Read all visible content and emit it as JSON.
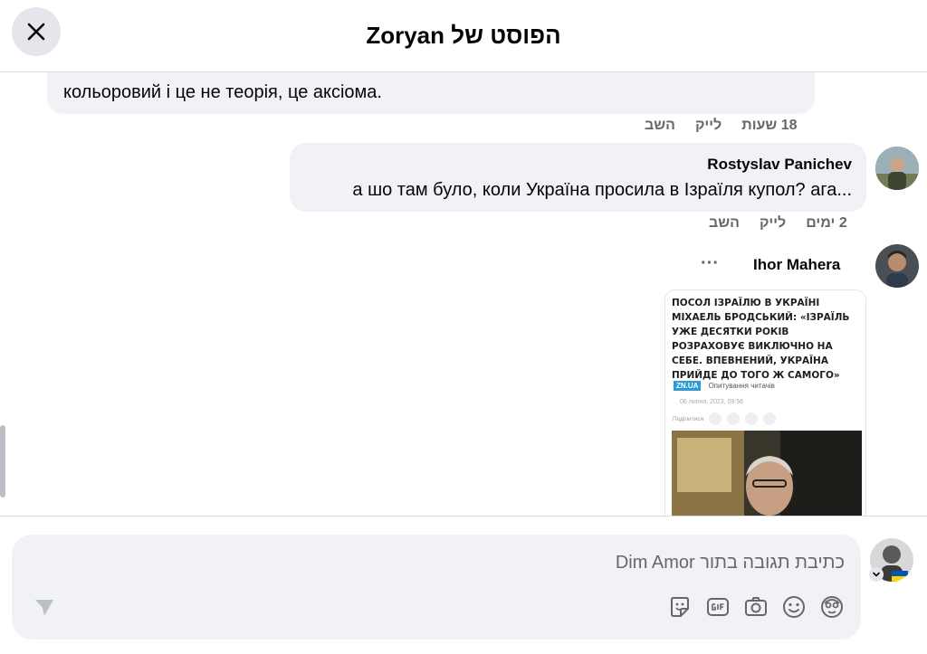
{
  "header": {
    "title": "הפוסט של Zoryan",
    "close_label": "×"
  },
  "comments": [
    {
      "text": "кольоровий і це не теорія, це аксіома.",
      "meta": {
        "time": "18 שעות",
        "like": "לייק",
        "reply": "השב"
      }
    },
    {
      "author": "Rostyslav Panichev",
      "text": "а шо там було, коли Україна просила в Ізраїля купол? ага...",
      "meta": {
        "time": "2 ימים",
        "like": "לייק",
        "reply": "השב"
      }
    },
    {
      "author": "Ihor Mahera",
      "more": "···",
      "attachment": {
        "headline_lines": [
          "ПОСОЛ ІЗРАЇЛЮ В УКРАЇНІ",
          "МІХАЕЛЬ БРОДСЬКИЙ: «ІЗРАЇЛЬ",
          "УЖЕ ДЕСЯТКИ РОКІВ",
          "РОЗРАХОВУЄ ВИКЛЮЧНО НА",
          "СЕБЕ. ВПЕВНЕНИЙ, УКРАЇНА",
          "ПРИЙДЕ ДО ТОГО Ж САМОГО»"
        ],
        "source_badge": "ZN.UA",
        "source_label": "Опитування читачів",
        "date": "06 липня, 2023, 09:56",
        "share_label": "Поділитися"
      }
    }
  ],
  "composer": {
    "placeholder": "כתיבת תגובה בתור Dim Amor"
  },
  "icons": [
    "close-icon",
    "sticker-icon",
    "gif-icon",
    "camera-icon",
    "emoji-icon",
    "avatar-icon",
    "send-icon",
    "chevron-down-icon"
  ]
}
